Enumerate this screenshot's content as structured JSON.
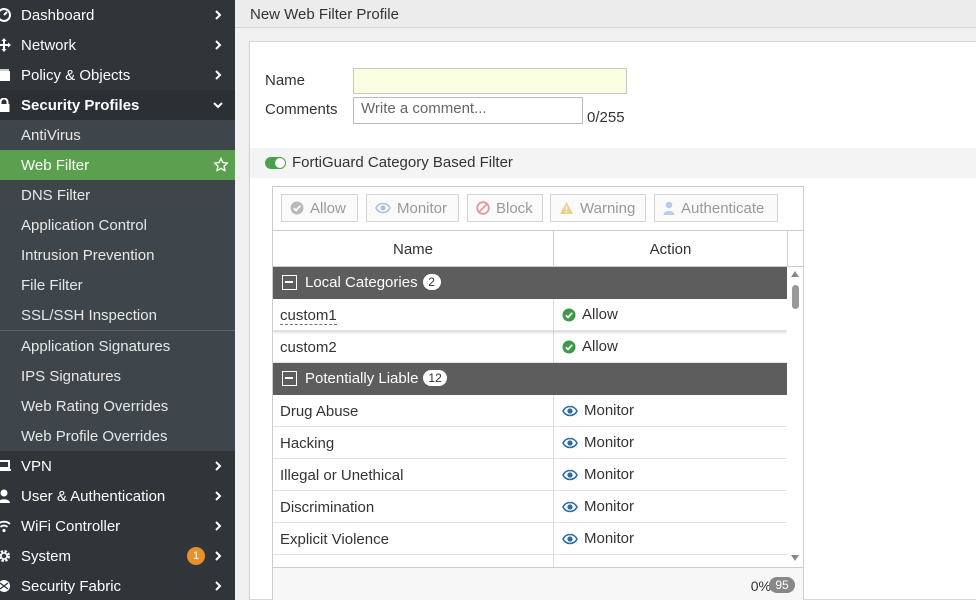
{
  "sidebar": {
    "top_items": [
      {
        "label": "Dashboard",
        "icon": "dashboard-icon"
      },
      {
        "label": "Network",
        "icon": "network-icon"
      },
      {
        "label": "Policy & Objects",
        "icon": "policy-icon"
      }
    ],
    "security_profiles": {
      "label": "Security Profiles",
      "items": [
        "AntiVirus",
        "Web Filter",
        "DNS Filter",
        "Application Control",
        "Intrusion Prevention",
        "File Filter",
        "SSL/SSH Inspection"
      ],
      "active": "Web Filter",
      "items2": [
        "Application Signatures",
        "IPS Signatures",
        "Web Rating Overrides",
        "Web Profile Overrides"
      ]
    },
    "bottom_items": [
      {
        "label": "VPN",
        "icon": "laptop-icon"
      },
      {
        "label": "User & Authentication",
        "icon": "user-icon"
      },
      {
        "label": "WiFi Controller",
        "icon": "wifi-icon"
      },
      {
        "label": "System",
        "icon": "gear-icon",
        "badge": "1"
      },
      {
        "label": "Security Fabric",
        "icon": "fabric-icon"
      }
    ]
  },
  "header": {
    "title": "New Web Filter Profile"
  },
  "form": {
    "name_label": "Name",
    "name_value": "",
    "comments_label": "Comments",
    "comments_placeholder": "Write a comment...",
    "comments_count": "0/255"
  },
  "section": {
    "label": "FortiGuard Category Based Filter",
    "enabled": true
  },
  "action_buttons": [
    "Allow",
    "Monitor",
    "Block",
    "Warning",
    "Authenticate"
  ],
  "table": {
    "columns": [
      "Name",
      "Action"
    ],
    "groups": [
      {
        "label": "Local Categories",
        "count": "2",
        "rows": [
          {
            "name": "custom1",
            "action": "Allow"
          },
          {
            "name": "custom2",
            "action": "Allow"
          }
        ]
      },
      {
        "label": "Potentially Liable",
        "count": "12",
        "rows": [
          {
            "name": "Drug Abuse",
            "action": "Monitor"
          },
          {
            "name": "Hacking",
            "action": "Monitor"
          },
          {
            "name": "Illegal or Unethical",
            "action": "Monitor"
          },
          {
            "name": "Discrimination",
            "action": "Monitor"
          },
          {
            "name": "Explicit Violence",
            "action": "Monitor"
          }
        ]
      }
    ],
    "footer_percent": "0%",
    "footer_total": "95"
  },
  "colors": {
    "active_green": "#5aa04e",
    "sidebar_bg": "#333a3f",
    "monitor_blue": "#2b6da3",
    "allow_green": "#3c9a46",
    "badge_orange": "#e8902a"
  }
}
